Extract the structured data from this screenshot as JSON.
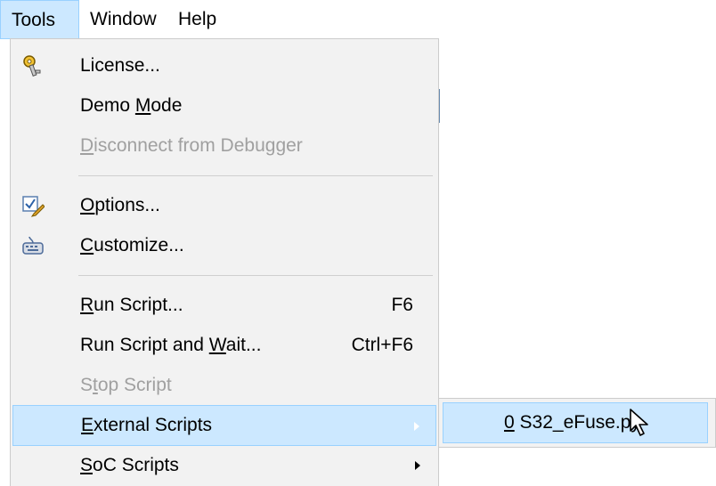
{
  "menubar": {
    "items": [
      {
        "label": "Tools",
        "active": true
      },
      {
        "label": "Window",
        "active": false
      },
      {
        "label": "Help",
        "active": false
      }
    ]
  },
  "menu": {
    "license": {
      "pre": "License...",
      "u": "",
      "post": "",
      "icon": "key-icon"
    },
    "demo_mode": {
      "pre": "Demo ",
      "u": "M",
      "post": "ode"
    },
    "disconnect": {
      "pre": "",
      "u": "D",
      "post": "isconnect from Debugger"
    },
    "options": {
      "pre": "",
      "u": "O",
      "post": "ptions...",
      "icon": "checklist-pencil-icon"
    },
    "customize": {
      "pre": "",
      "u": "C",
      "post": "ustomize...",
      "icon": "keyboard-icon"
    },
    "run_script": {
      "pre": "",
      "u": "R",
      "post": "un Script...",
      "shortcut": "F6"
    },
    "run_script_wait": {
      "pre": "Run Script and ",
      "u": "W",
      "post": "ait...",
      "shortcut": "Ctrl+F6"
    },
    "stop_script": {
      "pre": "S",
      "u": "t",
      "post": "op Script"
    },
    "external_scripts": {
      "pre": "",
      "u": "E",
      "post": "xternal Scripts"
    },
    "soc_scripts": {
      "pre": "",
      "u": "S",
      "post": "oC Scripts"
    }
  },
  "submenu": {
    "item": {
      "pre": "",
      "u": "0",
      "post": " S32_eFuse.py"
    }
  },
  "colors": {
    "highlight_bg": "#cce8ff",
    "highlight_border": "#99d1ff",
    "menu_bg": "#f2f2f2",
    "disabled_text": "#a0a0a0"
  }
}
